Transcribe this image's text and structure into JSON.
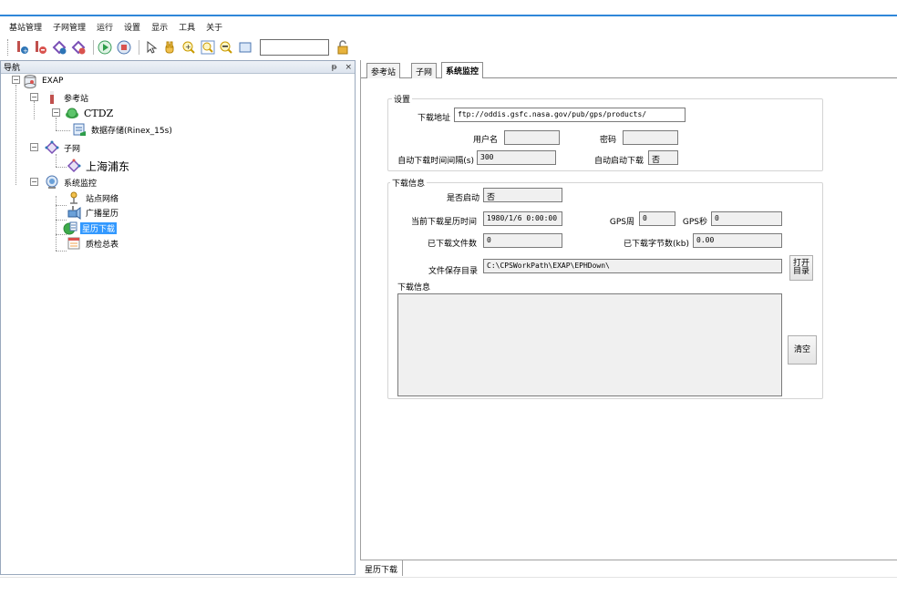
{
  "menu": [
    "基站管理",
    "子网管理",
    "运行",
    "设置",
    "显示",
    "工具",
    "关于"
  ],
  "nav": {
    "title": "导航",
    "pin": "ᵽ",
    "close": "×",
    "tree": {
      "root": "EXAP",
      "ref_station": "参考站",
      "ctdz": "CTDZ",
      "storage": "数据存储(Rinex_15s)",
      "subnet": "子网",
      "shanghai": "上海浦东",
      "monitor": "系统监控",
      "station_net": "站点网络",
      "broadcast": "广播星历",
      "ephemeris": "星历下载",
      "quality": "质检总表"
    }
  },
  "tabs": [
    "参考站",
    "子网",
    "系统监控"
  ],
  "settings": {
    "title": "设置",
    "url_label": "下载地址",
    "url_value": "ftp://oddis.gsfc.nasa.gov/pub/gps/products/",
    "user_label": "用户名",
    "user_value": "",
    "password_label": "密码",
    "password_value": "",
    "interval_label": "自动下载时间间隔(s)",
    "interval_value": "300",
    "autostart_label": "自动启动下载",
    "autostart_value": "否"
  },
  "download_info": {
    "title": "下载信息",
    "enabled_label": "是否启动",
    "enabled_value": "否",
    "time_label": "当前下载星历时间",
    "time_value": "1980/1/6 0:00:00",
    "gps_week_label": "GPS周",
    "gps_week_value": "0",
    "gps_sec_label": "GPS秒",
    "gps_sec_value": "0",
    "files_label": "已下载文件数",
    "files_value": "0",
    "bytes_label": "已下载字节数(kb)",
    "bytes_value": "0.00",
    "dir_label": "文件保存目录",
    "dir_value": "C:\\CPSWorkPath\\EXAP\\EPHDown\\",
    "open_dir_button": "打开目录",
    "log_label": "下载信息",
    "clear_button": "清空"
  },
  "bottom_tab": "星历下载",
  "colors": {
    "accent": "#2f87d9",
    "selection": "#3399ff"
  }
}
